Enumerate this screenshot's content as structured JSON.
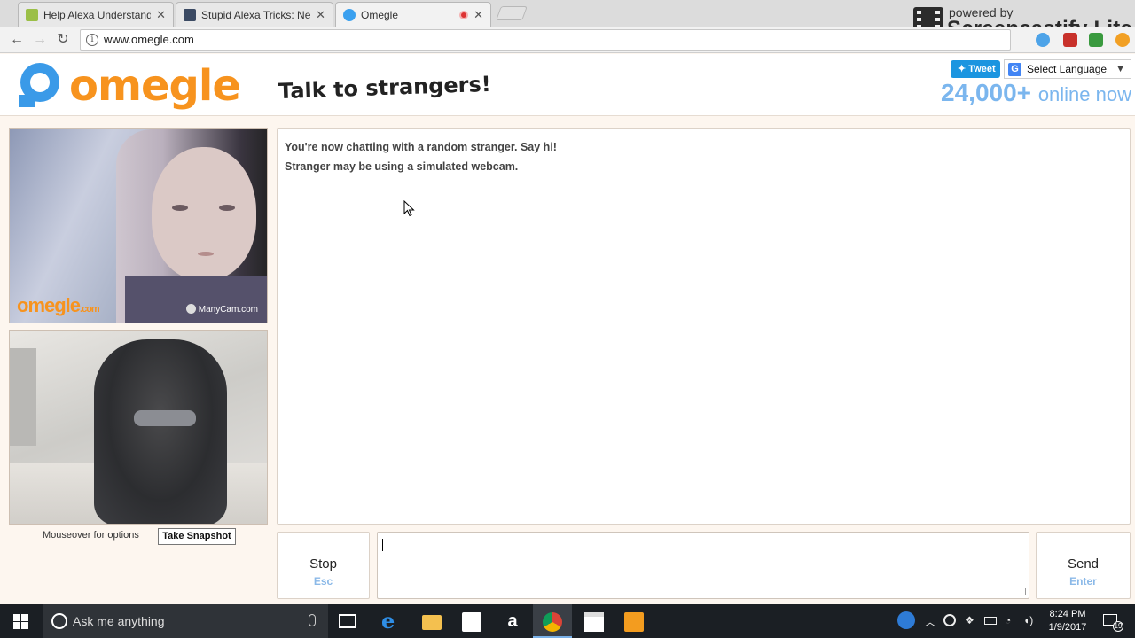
{
  "browser": {
    "tabs": [
      {
        "title": "Help Alexa Understand Y",
        "favicon_color": "#9bbf47"
      },
      {
        "title": "Stupid Alexa Tricks: New",
        "favicon_color": "#3b4a63"
      },
      {
        "title": "Omegle",
        "favicon_color": "#3aa0ef"
      }
    ],
    "url": "www.omegle.com",
    "close_glyph": "✕"
  },
  "watermark": {
    "powered_by": "powered by",
    "brand": "Screencastify Lite"
  },
  "site": {
    "logo_text": "omegle",
    "tagline": "Talk to strangers!",
    "tweet_label": "Tweet",
    "language_label": "Select Language",
    "online_count": "24,000+",
    "online_suffix": "online now",
    "brand_color": "#f7931e",
    "accent_color": "#7bb6ee"
  },
  "video": {
    "stranger_watermark_omegle": "omegle",
    "stranger_watermark_tld": ".com",
    "stranger_watermark_manycam": "ManyCam.com",
    "options_text": "Mouseover for options",
    "snapshot_label": "Take Snapshot"
  },
  "chat": {
    "messages": [
      "You're now chatting with a random stranger. Say hi!",
      "Stranger may be using a simulated webcam."
    ],
    "stop_label": "Stop",
    "stop_key": "Esc",
    "send_label": "Send",
    "send_key": "Enter",
    "message_value": ""
  },
  "taskbar": {
    "search_placeholder": "Ask me anything",
    "time": "8:24 PM",
    "date": "1/9/2017",
    "notification_count": "19",
    "pinned_icons": [
      "task-view-icon",
      "edge-icon",
      "file-explorer-icon",
      "store-icon",
      "amazon-icon",
      "chrome-icon",
      "calendar-icon",
      "audible-icon"
    ]
  }
}
